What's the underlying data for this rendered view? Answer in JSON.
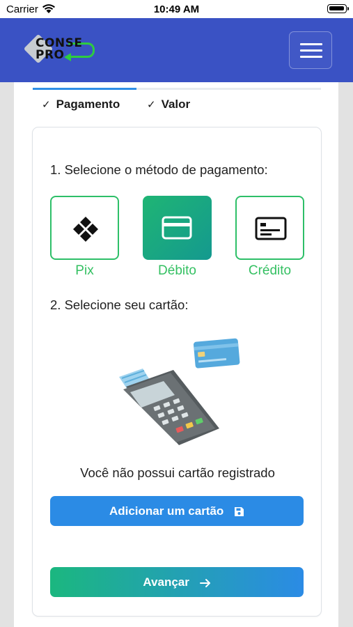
{
  "status_bar": {
    "carrier": "Carrier",
    "time": "10:49 AM"
  },
  "header": {
    "logo_line1": "CONSE",
    "logo_line2": "PRO",
    "menu_icon": "hamburger-icon",
    "colors": {
      "header_bg": "#3a52c4",
      "logo_arrow": "#2ecc40"
    }
  },
  "steps": {
    "active_progress": 0.36,
    "items": [
      {
        "check": "✓",
        "label": "Pagamento"
      },
      {
        "check": "✓",
        "label": "Valor"
      }
    ]
  },
  "payment": {
    "title": "1. Selecione o método de pagamento:",
    "methods": [
      {
        "label": "Pix",
        "icon": "pix-icon",
        "selected": false
      },
      {
        "label": "Débito",
        "icon": "debit-card-icon",
        "selected": true
      },
      {
        "label": "Crédito",
        "icon": "credit-card-icon",
        "selected": false
      }
    ]
  },
  "card_section": {
    "title": "2. Selecione seu cartão:",
    "illustration": "card-machine-illustration",
    "empty_message": "Você não possui cartão registrado",
    "add_button": "Adicionar um cartão",
    "add_icon": "save-icon"
  },
  "footer": {
    "next_button": "Avançar",
    "next_icon": "arrow-right-icon"
  },
  "colors": {
    "primary": "#2b8be5",
    "green": "#2dbf68",
    "gradient_start": "#1bb77f"
  }
}
